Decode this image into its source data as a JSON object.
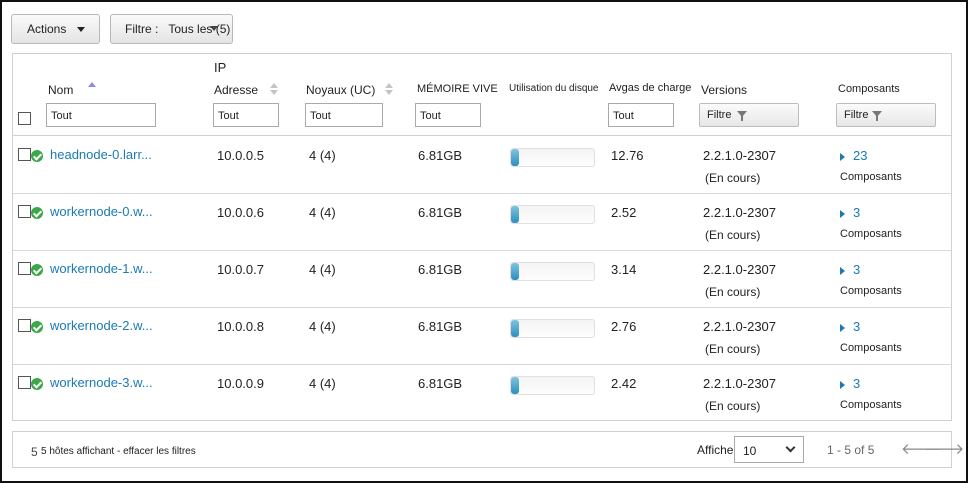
{
  "toolbar": {
    "actions_label": "Actions",
    "filter_label": "Filtre :",
    "filter_value": "Tous les (5)"
  },
  "columns": {
    "name": "Nom",
    "ip_top": "IP",
    "ip_bottom": "Adresse",
    "cores": "Noyaux (UC)",
    "memory": "MÉMOIRE VIVE",
    "disk": "Utilisation du disque",
    "load": "Avgas de charge",
    "versions": "Versions",
    "components": "Composants"
  },
  "filters": {
    "name_value": "Tout",
    "ip_value": "Tout",
    "cores_value": "Tout",
    "memory_value": "Tout",
    "load_value": "Tout",
    "versions_label": "Filtre",
    "components_label": "Filtre"
  },
  "rows": [
    {
      "name": "headnode-0.larr...",
      "ip": "10.0.0.5",
      "cores": "4 (4)",
      "memory": "6.81GB",
      "disk_usage_fraction": 0.08,
      "load": "12.76",
      "version": "2.2.1.0-2307",
      "status": "(En cours)",
      "components_count": "23",
      "components_label": "Composants"
    },
    {
      "name": "workernode-0.w...",
      "ip": "10.0.0.6",
      "cores": "4 (4)",
      "memory": "6.81GB",
      "disk_usage_fraction": 0.08,
      "load": "2.52",
      "version": "2.2.1.0-2307",
      "status": "(En cours)",
      "components_count": "3",
      "components_label": "Composants"
    },
    {
      "name": "workernode-1.w...",
      "ip": "10.0.0.7",
      "cores": "4 (4)",
      "memory": "6.81GB",
      "disk_usage_fraction": 0.08,
      "load": "3.14",
      "version": "2.2.1.0-2307",
      "status": "(En cours)",
      "components_count": "3",
      "components_label": "Composants"
    },
    {
      "name": "workernode-2.w...",
      "ip": "10.0.0.8",
      "cores": "4 (4)",
      "memory": "6.81GB",
      "disk_usage_fraction": 0.08,
      "load": "2.76",
      "version": "2.2.1.0-2307",
      "status": "(En cours)",
      "components_count": "3",
      "components_label": "Composants"
    },
    {
      "name": "workernode-3.w...",
      "ip": "10.0.0.9",
      "cores": "4 (4)",
      "memory": "6.81GB",
      "disk_usage_fraction": 0.08,
      "load": "2.42",
      "version": "2.2.1.0-2307",
      "status": "(En cours)",
      "components_count": "3",
      "components_label": "Composants"
    }
  ],
  "footer": {
    "count": "5",
    "summary": "5 hôtes affichant - effacer les filtres",
    "show_label": "Afficher :",
    "page_size": "10",
    "range": "1 - 5 of 5",
    "prev_icon": "arrow-left-icon",
    "next_icon": "arrow-right-icon"
  },
  "colors": {
    "link": "#1a7ab4",
    "status_ok": "#3aa848",
    "bar_fill": "#2b8fbf"
  }
}
